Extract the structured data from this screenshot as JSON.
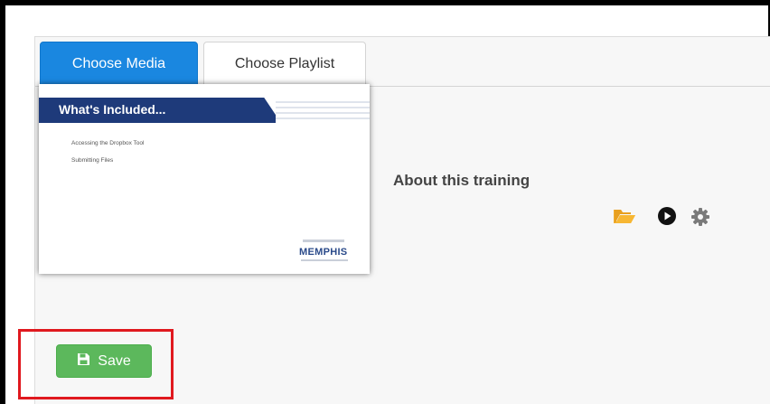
{
  "tabs": [
    {
      "label": "Choose Media",
      "active": true
    },
    {
      "label": "Choose Playlist",
      "active": false
    }
  ],
  "media": {
    "title": "About this training",
    "thumbnail": {
      "heading": "What's Included...",
      "items": [
        "Accessing the Dropbox Tool",
        "Submitting Files"
      ],
      "logo_text": "MEMPHIS"
    },
    "icons": [
      "folder-open-icon",
      "play-circle-icon",
      "gear-icon"
    ]
  },
  "save": {
    "label": "Save"
  },
  "colors": {
    "tab_active": "#1a87e0",
    "save_button": "#5cb85c",
    "highlight_outline": "#e0191f",
    "folder_icon": "#f0ad2e"
  }
}
